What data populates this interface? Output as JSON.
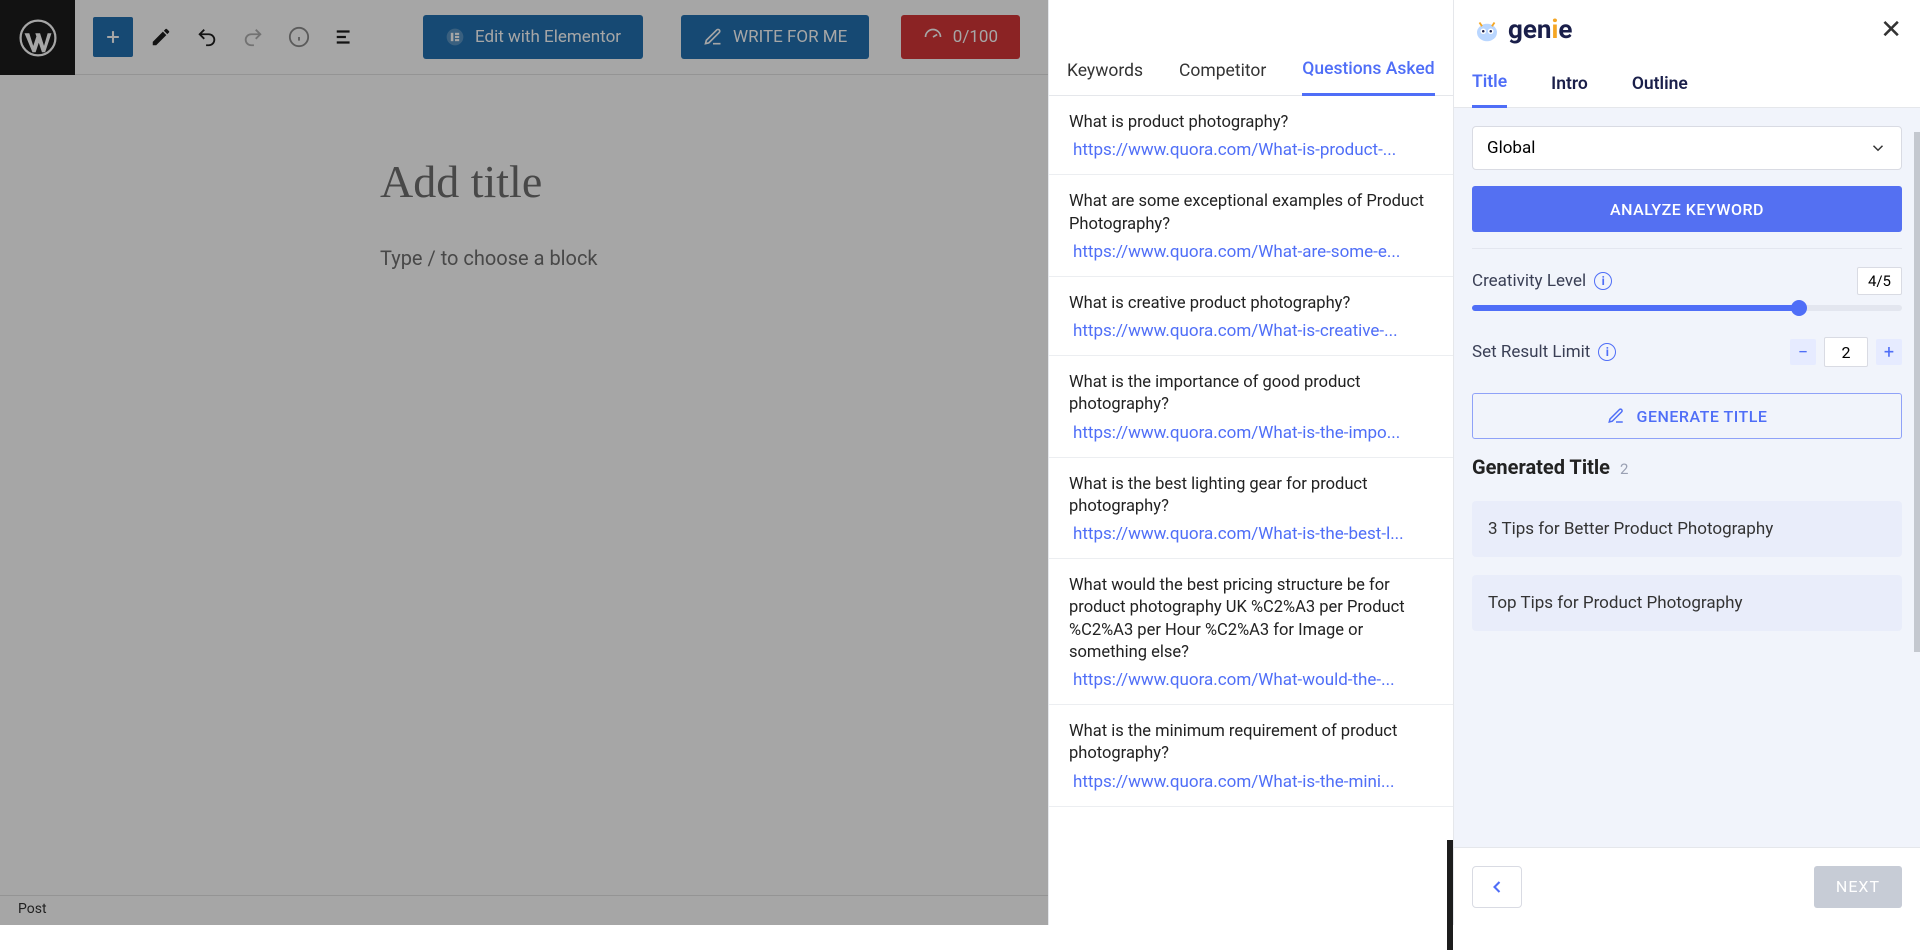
{
  "wp": {
    "title_placeholder": "Add title",
    "block_placeholder": "Type / to choose a block",
    "edit_elementor": "Edit with Elementor",
    "write_for_me": "WRITE FOR ME",
    "score": "0/100",
    "footer": "Post"
  },
  "mid": {
    "tabs": [
      "Keywords",
      "Competitor",
      "Questions Asked"
    ],
    "active_tab": 2,
    "questions": [
      {
        "q": "What is product photography?",
        "url": "https://www.quora.com/What-is-product-..."
      },
      {
        "q": "What are some exceptional examples of Product Photography?",
        "url": "https://www.quora.com/What-are-some-e..."
      },
      {
        "q": "What is creative product photography?",
        "url": "https://www.quora.com/What-is-creative-..."
      },
      {
        "q": "What is the importance of good product photography?",
        "url": "https://www.quora.com/What-is-the-impo..."
      },
      {
        "q": "What is the best lighting gear for product photography?",
        "url": "https://www.quora.com/What-is-the-best-l..."
      },
      {
        "q": "What would the best pricing structure be for product photography UK %C2%A3 per Product %C2%A3 per Hour %C2%A3 for Image or something else?",
        "url": "https://www.quora.com/What-would-the-..."
      },
      {
        "q": "What is the minimum requirement of product photography?",
        "url": "https://www.quora.com/What-is-the-mini..."
      }
    ]
  },
  "right": {
    "brand": "genie",
    "tabs": [
      "Title",
      "Intro",
      "Outline"
    ],
    "active_tab": 0,
    "region": "Global",
    "analyze_btn": "ANALYZE KEYWORD",
    "creativity_label": "Creativity Level",
    "creativity_value": "4/5",
    "result_limit_label": "Set Result Limit",
    "result_limit_value": "2",
    "generate_btn": "GENERATE TITLE",
    "generated_title_label": "Generated Title",
    "generated_count": "2",
    "results": [
      "3 Tips for Better Product Photography",
      "Top Tips for Product Photography"
    ],
    "next": "NEXT"
  }
}
